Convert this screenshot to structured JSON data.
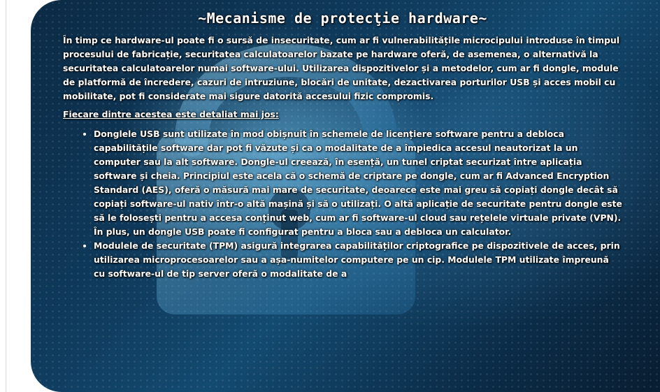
{
  "title": "~Mecanisme de protecţie hardware~",
  "intro": "În timp ce hardware-ul poate fi o sursă de insecuritate, cum ar fi vulnerabilitățile microcipului introduse în timpul procesului de fabricație, securitatea calculatoarelor bazate pe hardware oferă, de asemenea, o alternativă la securitatea calculatoarelor numai software-ului. Utilizarea dispozitivelor și a metodelor, cum ar fi dongle, module de platformă de încredere, cazuri de intruziune, blocări de unitate, dezactivarea porturilor USB și acces mobil cu mobilitate, pot fi considerate mai sigure datorită accesului fizic compromis.",
  "detail_link": "Fiecare dintre acestea este detaliat mai jos:",
  "items": [
    "Donglele USB sunt utilizate în mod obișnuit în schemele de licențiere software pentru a debloca capabilitățile software dar pot fi văzute și ca o modalitate de a împiedica accesul neautorizat la un computer sau la alt software. Dongle-ul creează, în esență, un tunel criptat securizat între aplicația software și cheia. Principiul este acela că o schemă de criptare pe dongle, cum ar fi Advanced Encryption Standard (AES), oferă o măsură mai mare de securitate, deoarece este mai greu să copiați dongle decât să copiați software-ul nativ într-o altă mașină și să o utilizați. O altă aplicație de securitate pentru dongle este să le folosești pentru a accesa conținut web, cum ar fi software-ul cloud sau rețelele virtuale private (VPN). În plus, un dongle USB poate fi configurat pentru a bloca sau a debloca un calculator.",
    "Modulele de securitate (TPM) asigură integrarea capabilităților criptografice pe dispozitivele de acces, prin utilizarea microprocesoarelor sau a așa-numitelor computere pe un cip. Modulele TPM utilizate împreună cu software-ul de tip server oferă o modalitate de a"
  ],
  "background": {
    "icon": "padlock-icon",
    "colors": {
      "primary": "#0f3a5c",
      "glow": "#78c8f0"
    }
  }
}
